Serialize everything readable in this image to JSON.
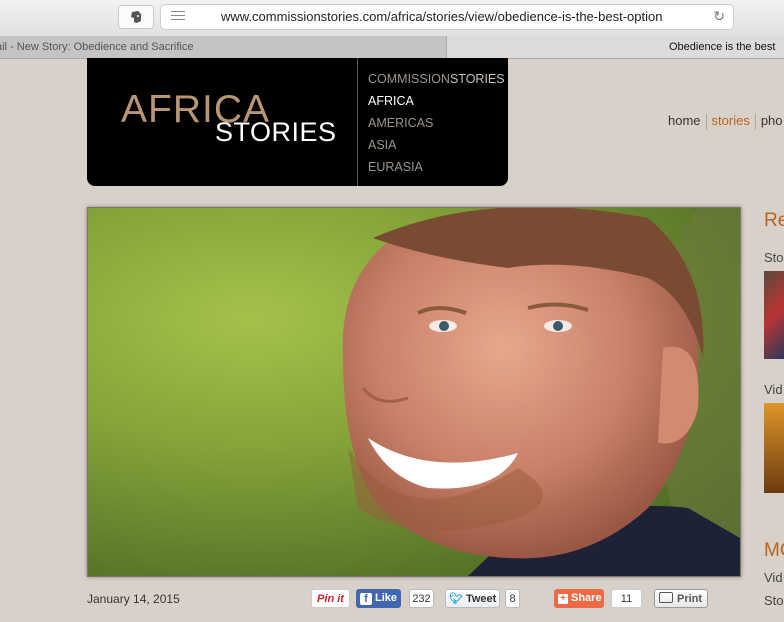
{
  "browser": {
    "url": "www.commissionstories.com/africa/stories/view/obedience-is-the-best-option",
    "tabs": [
      {
        "label": "ail - New Story: Obedience and Sacrifice"
      },
      {
        "label": "Obedience is the best"
      }
    ]
  },
  "brand": {
    "logo_line1": "AFRICA",
    "logo_line2": "STORIES",
    "regions": [
      {
        "label_a": "COMMISSION",
        "label_b": "STORIES"
      },
      {
        "label": "AFRICA"
      },
      {
        "label": "AMERICAS"
      },
      {
        "label": "ASIA"
      },
      {
        "label": "EURASIA"
      }
    ]
  },
  "nav": {
    "home": "home",
    "stories": "stories",
    "photos": "pho"
  },
  "article": {
    "date": "January 14, 2015"
  },
  "share": {
    "pinit": "Pin it",
    "facebook_label": "Like",
    "facebook_count": "232",
    "tweet_label": "Tweet",
    "tweet_count": "8",
    "share_label": "Share",
    "share_count": "11",
    "print_label": "Print"
  },
  "sidebar": {
    "heading1": "Re",
    "sub1": "Sto",
    "sub2": "Vid",
    "heading2": "MC",
    "sub3": "Vid",
    "sub4": "Sto"
  },
  "colors": {
    "accent": "#b8641f",
    "page_bg": "#d8d1c9",
    "facebook": "#4267b2",
    "share": "#ee6a47"
  }
}
